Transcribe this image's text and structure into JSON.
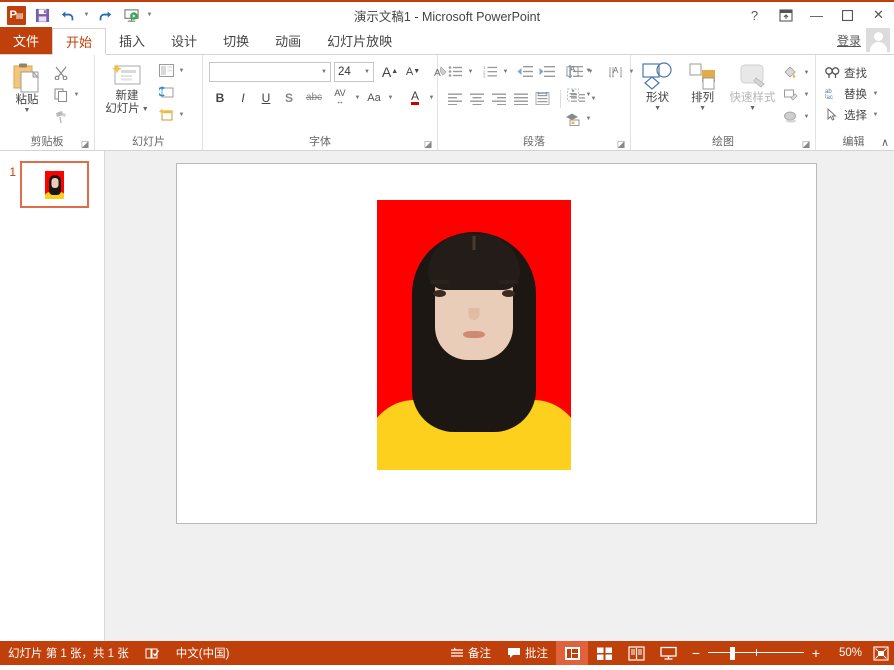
{
  "window": {
    "title": "演示文稿1 - Microsoft PowerPoint",
    "help_icon": "?",
    "ribbon_options_icon": "ribbon-display-options-icon",
    "minimize_icon": "—",
    "maximize_icon": "▫",
    "close_icon": "✕"
  },
  "quick_access": {
    "app_logo": "P",
    "items": [
      {
        "name": "save-button",
        "icon": "save-icon"
      },
      {
        "name": "undo-button",
        "icon": "undo-icon"
      },
      {
        "name": "redo-button",
        "icon": "redo-icon"
      },
      {
        "name": "start-slideshow-button",
        "icon": "slideshow-icon"
      },
      {
        "name": "customize-qat-button",
        "icon": "chevron-down-icon"
      }
    ]
  },
  "tabs": {
    "file": "文件",
    "items": [
      {
        "label": "开始",
        "active": true
      },
      {
        "label": "插入",
        "active": false
      },
      {
        "label": "设计",
        "active": false
      },
      {
        "label": "切换",
        "active": false
      },
      {
        "label": "动画",
        "active": false
      },
      {
        "label": "幻灯片放映",
        "active": false
      }
    ],
    "signin": "登录"
  },
  "ribbon": {
    "clipboard": {
      "label": "剪贴板",
      "paste": "粘贴",
      "cut": "剪切",
      "copy": "复制",
      "format_painter": "格式刷"
    },
    "slides": {
      "label": "幻灯片",
      "new_slide_line1": "新建",
      "new_slide_line2": "幻灯片",
      "layout": "版式",
      "reset": "重置",
      "section": "节"
    },
    "font": {
      "label": "字体",
      "font_name_value": "",
      "font_name_placeholder": "",
      "font_size_value": "24",
      "grow_font": "A",
      "shrink_font": "A",
      "clear_formatting": "清除所有格式",
      "bold": "B",
      "italic": "I",
      "underline": "U",
      "shadow": "S",
      "strikethrough": "abc",
      "char_spacing": "AV",
      "change_case": "Aa",
      "font_color": "A"
    },
    "paragraph": {
      "label": "段落",
      "bullets": "项目符号",
      "numbering": "编号",
      "decrease_indent": "减少缩进量",
      "increase_indent": "增加缩进量",
      "line_spacing": "行距",
      "text_direction": "文字方向",
      "align_text": "对齐文本",
      "convert_smartart": "转换为 SmartArt",
      "align_left": "左对齐",
      "align_center": "居中",
      "align_right": "右对齐",
      "justify": "两端对齐",
      "columns": "分栏"
    },
    "drawing": {
      "label": "绘图",
      "shapes": "形状",
      "arrange": "排列",
      "quick_styles": "快速样式",
      "shape_fill": "形状填充",
      "shape_outline": "形状轮廓",
      "shape_effects": "形状效果"
    },
    "editing": {
      "label": "编辑",
      "find": "查找",
      "replace": "替换",
      "select": "选择",
      "collapse": "∧"
    }
  },
  "thumbnails": [
    {
      "number": "1",
      "selected": true
    }
  ],
  "slide": {
    "photo_alt": "id-photo",
    "photo_background": "#fe0000",
    "shirt_color": "#fcd01c",
    "hair_color": "#1d1714",
    "skin_color": "#e9cdb9"
  },
  "status": {
    "slide_count": "幻灯片 第 1 张，共 1 张",
    "proofing_icon": "proofing-icon",
    "language": "中文(中国)",
    "notes": "备注",
    "comments": "批注",
    "views": [
      {
        "name": "normal-view",
        "icon": "normal-view-icon",
        "active": true
      },
      {
        "name": "slide-sorter-view",
        "icon": "slide-sorter-icon",
        "active": false
      },
      {
        "name": "reading-view",
        "icon": "reading-view-icon",
        "active": false
      },
      {
        "name": "slideshow-view",
        "icon": "slideshow-icon",
        "active": false
      }
    ],
    "zoom_out": "−",
    "zoom_in": "+",
    "zoom_level": "50%",
    "fit_window_icon": "fit-to-window-icon"
  },
  "colors": {
    "accent": "#c0400c",
    "tab_active_text": "#c0400c",
    "thumb_border": "#e06c4a"
  }
}
